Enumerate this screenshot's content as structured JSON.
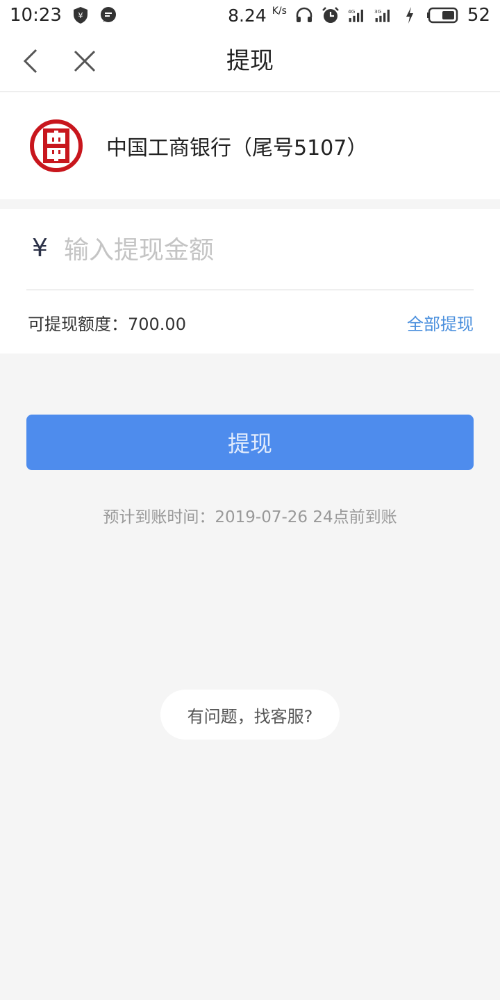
{
  "status_bar": {
    "time": "10:23",
    "net_speed": "8.24",
    "net_speed_unit": "K/s",
    "battery_level": "52"
  },
  "nav": {
    "title": "提现"
  },
  "bank": {
    "name": "中国工商银行（尾号5107）",
    "logo_color": "#c8161d"
  },
  "amount": {
    "currency": "¥",
    "placeholder": "输入提现金额",
    "value": "",
    "available_label": "可提现额度：700.00",
    "withdraw_all": "全部提现"
  },
  "submit": {
    "label": "提现",
    "color": "#4e8ced"
  },
  "eta": "预计到账时间：2019-07-26 24点前到账",
  "support": {
    "label": "有问题，找客服?"
  },
  "accent_link_color": "#4a8fdd"
}
